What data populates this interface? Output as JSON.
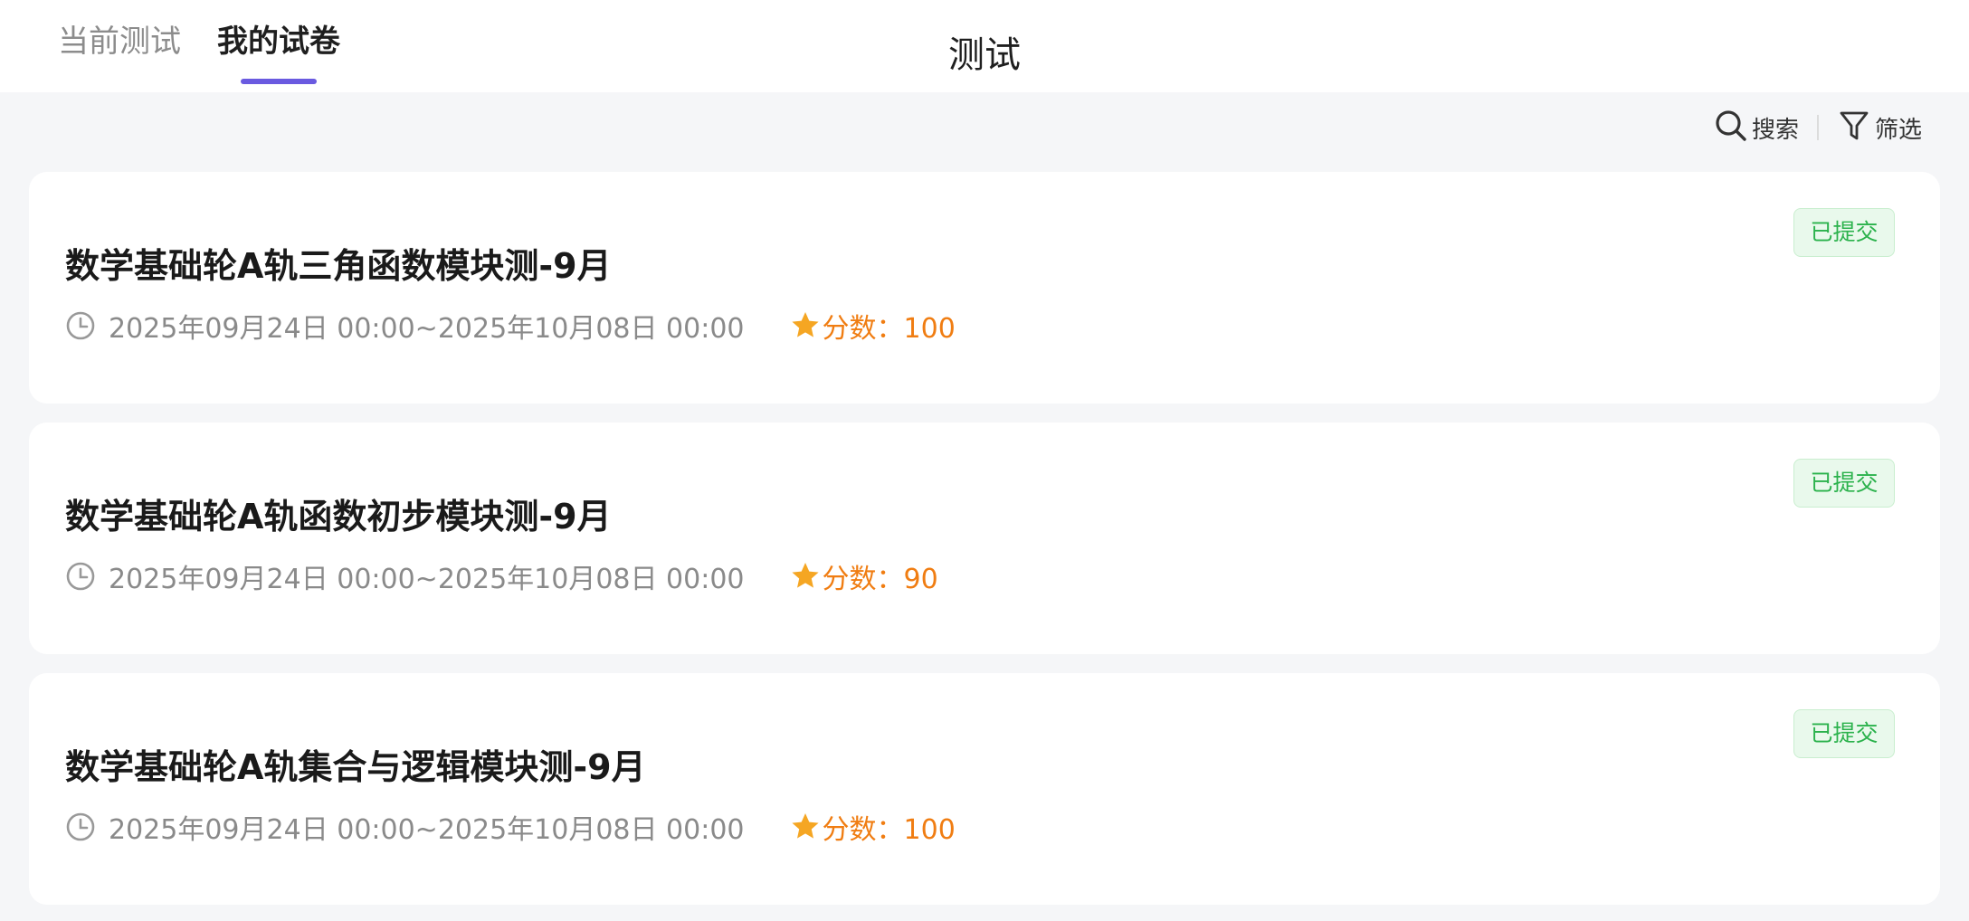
{
  "header": {
    "tabs": [
      {
        "label": "当前测试",
        "active": false
      },
      {
        "label": "我的试卷",
        "active": true
      }
    ],
    "title": "测试",
    "accent_color": "#6a5ae0"
  },
  "toolbar": {
    "search_label": "搜索",
    "filter_label": "筛选",
    "search_icon": "search-icon",
    "filter_icon": "funnel-icon"
  },
  "exams": [
    {
      "title": "数学基础轮A轨三角函数模块测-9月",
      "time_range": "2025年09月24日 00:00~2025年10月08日 00:00",
      "score_label": "分数：100",
      "status": "已提交"
    },
    {
      "title": "数学基础轮A轨函数初步模块测-9月",
      "time_range": "2025年09月24日 00:00~2025年10月08日 00:00",
      "score_label": "分数：90",
      "status": "已提交"
    },
    {
      "title": "数学基础轮A轨集合与逻辑模块测-9月",
      "time_range": "2025年09月24日 00:00~2025年10月08日 00:00",
      "score_label": "分数：100",
      "status": "已提交"
    }
  ],
  "colors": {
    "status_green": "#2bb24c",
    "score_orange": "#f07d12",
    "background": "#f5f6f8"
  }
}
